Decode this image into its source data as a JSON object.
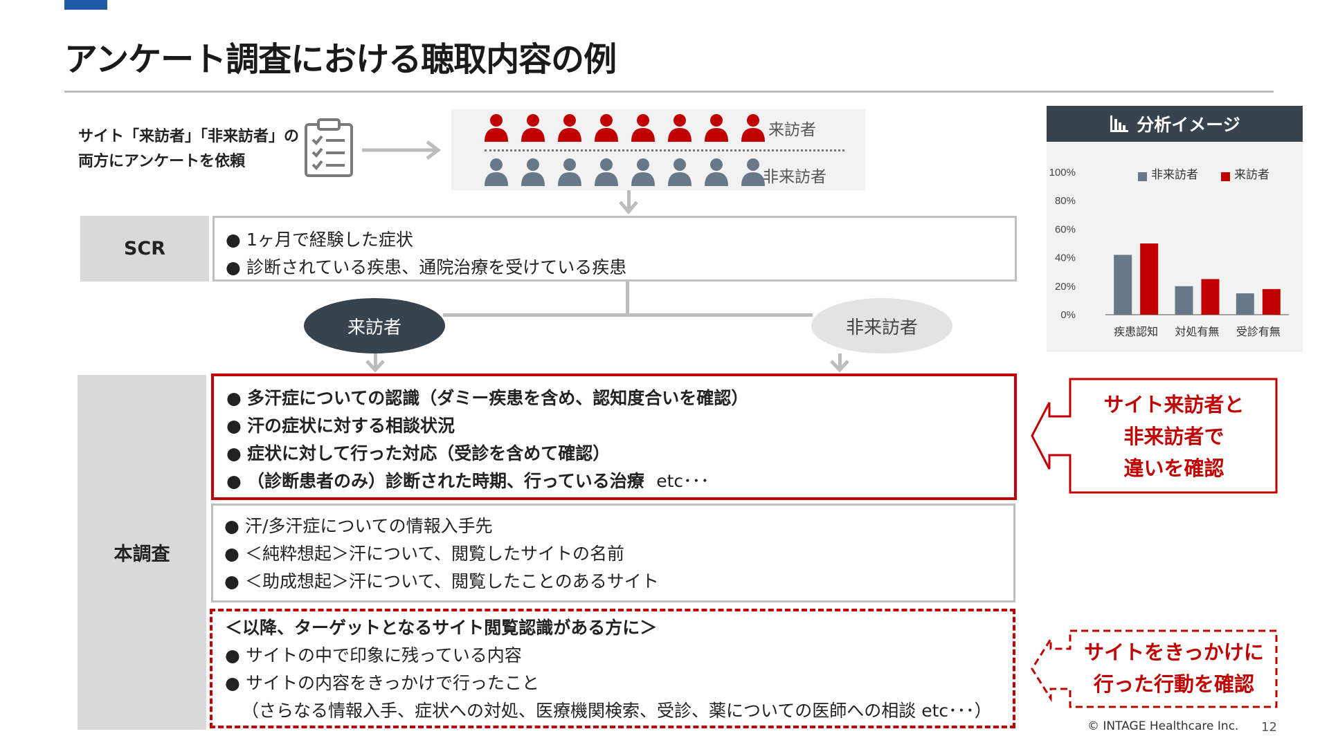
{
  "title": "アンケート調査における聴取内容の例",
  "intro": {
    "line1": "サイト「来訪者」「非来訪者」の",
    "line2": "両方にアンケートを依頼"
  },
  "icons": {
    "clipboard": "clipboard-checklist-icon",
    "person": "person-icon",
    "chart": "bar-chart-icon"
  },
  "colors": {
    "accent_red": "#c00000",
    "dark_slate": "#37444e",
    "grey_person": "#677988",
    "corner_blue": "#1f5aa6"
  },
  "people": {
    "visitor_label": "来訪者",
    "nonvisitor_label": "非来訪者",
    "count_per_row": 8
  },
  "scr": {
    "label": "SCR",
    "items": [
      "1ヶ月で経験した症状",
      "診断されている疾患、通院治療を受けている疾患"
    ]
  },
  "branch": {
    "visitor": "来訪者",
    "nonvisitor": "非来訪者"
  },
  "main_survey": {
    "label": "本調査",
    "red_items": [
      "多汗症についての認識（ダミー疾患を含め、認知度合いを確認）",
      "汗の症状に対する相談状況",
      "症状に対して行った対応（受診を含めて確認）",
      "（診断患者のみ）診断された時期、行っている治療"
    ],
    "red_items_suffix": "etc･･･",
    "grey_items": [
      "汗/多汗症についての情報入手先",
      "＜純粋想起＞汗について、閲覧したサイトの名前",
      "＜助成想起＞汗について、閲覧したことのあるサイト"
    ],
    "dashed_heading": "＜以降、ターゲットとなるサイト閲覧認識がある方に＞",
    "dashed_items": [
      "サイトの中で印象に残っている内容",
      "サイトの内容をきっかけで行ったこと"
    ],
    "dashed_note": "（さらなる情報入手、症状への対処、医療機関検索、受診、薬についての医師への相談 etc･･･）"
  },
  "callouts": {
    "compare": [
      "サイト来訪者と",
      "非来訪者で",
      "違いを確認"
    ],
    "action": [
      "サイトをきっかけに",
      "行った行動を確認"
    ]
  },
  "chart_data": {
    "type": "bar",
    "title": "分析イメージ",
    "categories": [
      "疾患認知",
      "対処有無",
      "受診有無"
    ],
    "series": [
      {
        "name": "非来訪者",
        "color": "#677988",
        "values": [
          42,
          20,
          15
        ]
      },
      {
        "name": "来訪者",
        "color": "#c00000",
        "values": [
          50,
          25,
          18
        ]
      }
    ],
    "ylim": [
      0,
      100
    ],
    "yticks": [
      "0%",
      "20%",
      "40%",
      "60%",
      "80%",
      "100%"
    ],
    "legend_position": "top-right",
    "grid": false
  },
  "footer": {
    "copyright": "© INTAGE Healthcare Inc.",
    "page": "12"
  }
}
